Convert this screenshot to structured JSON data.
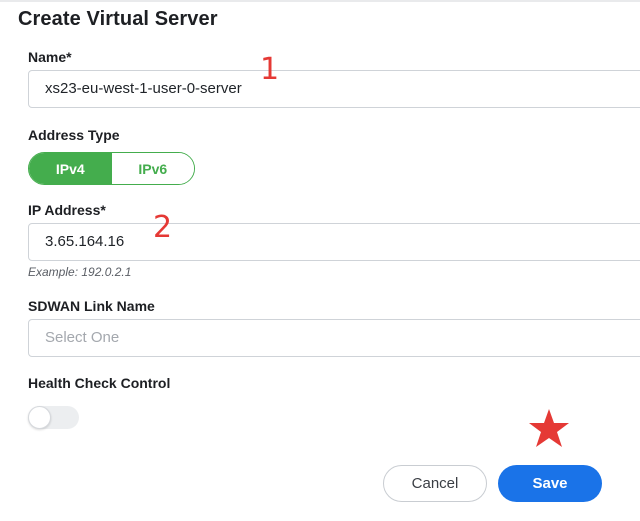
{
  "dialog": {
    "title": "Create Virtual Server"
  },
  "form": {
    "name": {
      "label": "Name*",
      "value": "xs23-eu-west-1-user-0-server"
    },
    "address_type": {
      "label": "Address Type",
      "options": [
        "IPv4",
        "IPv6"
      ],
      "selected": "IPv4"
    },
    "ip_address": {
      "label": "IP Address*",
      "value": "3.65.164.16",
      "hint": "Example: 192.0.2.1"
    },
    "sdwan_link": {
      "label": "SDWAN Link Name",
      "placeholder": "Select One"
    },
    "health_check": {
      "label": "Health Check Control",
      "enabled": false
    }
  },
  "annotations": {
    "one": "1",
    "two": "2",
    "star_icon": "star-icon"
  },
  "buttons": {
    "cancel": "Cancel",
    "save": "Save"
  },
  "colors": {
    "accent_green": "#44ad4d",
    "primary_blue": "#1a73e8",
    "annotation_red": "#e53935"
  }
}
